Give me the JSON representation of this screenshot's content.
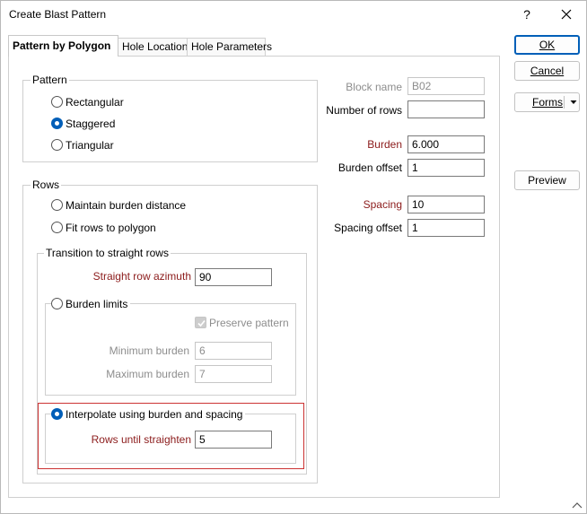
{
  "window": {
    "title": "Create Blast Pattern",
    "help": "?"
  },
  "tabs": [
    {
      "label": "Pattern by Polygon",
      "active": true
    },
    {
      "label": "Hole Location",
      "active": false
    },
    {
      "label": "Hole Parameters",
      "active": false
    }
  ],
  "pattern_group": {
    "label": "Pattern",
    "options": [
      {
        "label": "Rectangular",
        "checked": false
      },
      {
        "label": "Staggered",
        "checked": true
      },
      {
        "label": "Triangular",
        "checked": false
      }
    ]
  },
  "rows_group": {
    "label": "Rows",
    "options": [
      {
        "label": "Maintain burden distance",
        "checked": false
      },
      {
        "label": "Fit rows to polygon",
        "checked": false
      }
    ],
    "transition": {
      "label": "Transition to straight rows",
      "azimuth_label": "Straight row azimuth",
      "azimuth_value": "90",
      "burden_limits": {
        "label": "Burden limits",
        "checked": false,
        "preserve_label": "Preserve pattern",
        "preserve_checked": true,
        "min_label": "Minimum burden",
        "min_value": "6",
        "max_label": "Maximum burden",
        "max_value": "7"
      },
      "interpolate": {
        "label": "Interpolate using burden and spacing",
        "checked": true,
        "rows_label": "Rows until straighten",
        "rows_value": "5"
      }
    }
  },
  "right_fields": {
    "block_name": {
      "label": "Block name",
      "value": "B02"
    },
    "number_of_rows": {
      "label": "Number of rows",
      "value": ""
    },
    "burden": {
      "label": "Burden",
      "value": "6.000"
    },
    "burden_offset": {
      "label": "Burden offset",
      "value": "1"
    },
    "spacing": {
      "label": "Spacing",
      "value": "10"
    },
    "spacing_offset": {
      "label": "Spacing offset",
      "value": "1"
    }
  },
  "buttons": {
    "ok": "OK",
    "cancel": "Cancel",
    "forms": "Forms",
    "preview": "Preview"
  },
  "colors": {
    "accent": "#005fb8",
    "required_label": "#8b1a1a",
    "highlight": "#cc3333",
    "disabled": "#8d8d8d"
  }
}
